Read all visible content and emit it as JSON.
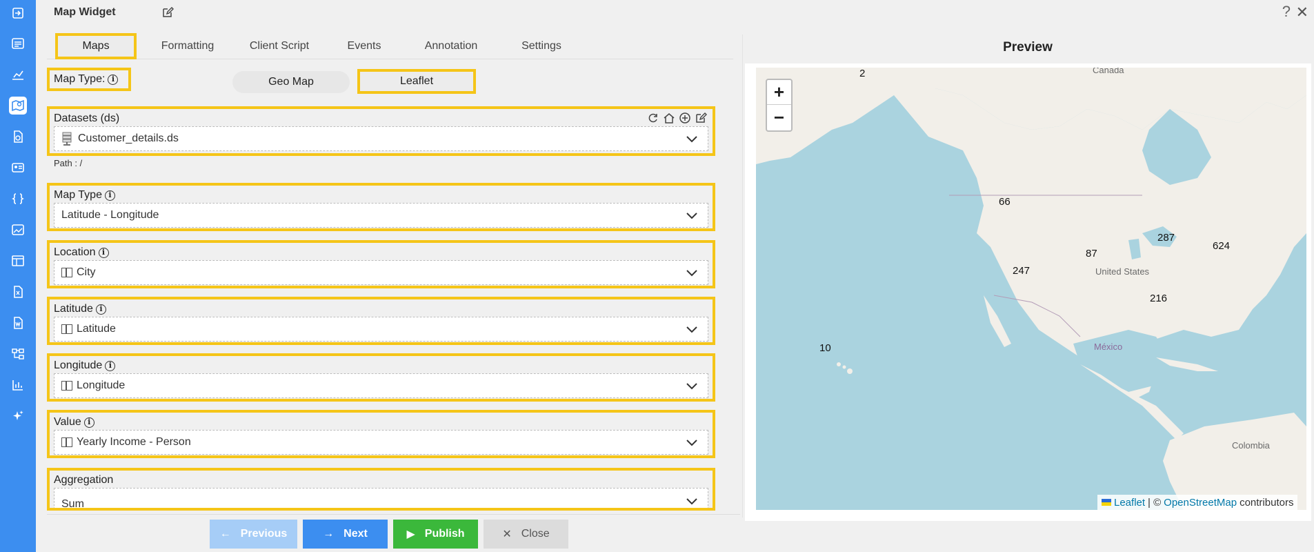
{
  "window": {
    "title": "Map Widget"
  },
  "tabs": [
    {
      "label": "Maps"
    },
    {
      "label": "Formatting"
    },
    {
      "label": "Client Script"
    },
    {
      "label": "Events"
    },
    {
      "label": "Annotation"
    },
    {
      "label": "Settings"
    }
  ],
  "map_type_top": {
    "label": "Map Type:",
    "options": [
      "Geo Map",
      "Leaflet"
    ],
    "selected": "Leaflet"
  },
  "datasets": {
    "label": "Datasets (ds)",
    "value": "Customer_details.ds",
    "path": "Path : /"
  },
  "fields": {
    "map_type": {
      "label": "Map Type",
      "value": "Latitude - Longitude"
    },
    "location": {
      "label": "Location",
      "value": "City"
    },
    "latitude": {
      "label": "Latitude",
      "value": "Latitude"
    },
    "longitude": {
      "label": "Longitude",
      "value": "Longitude"
    },
    "value": {
      "label": "Value",
      "value": "Yearly Income - Person"
    },
    "aggregation": {
      "label": "Aggregation",
      "value": "Sum"
    }
  },
  "buttons": {
    "previous": "Previous",
    "next": "Next",
    "publish": "Publish",
    "close": "Close"
  },
  "preview": {
    "title": "Preview",
    "zoom_in": "+",
    "zoom_out": "−",
    "bubble_values": [
      "2",
      "66",
      "87",
      "287",
      "624",
      "247",
      "216",
      "10"
    ],
    "places": {
      "canada": "Canada",
      "usa": "United States",
      "mexico": "México",
      "colombia": "Colombia"
    },
    "attribution": {
      "leaflet": "Leaflet",
      "sep": "| ©",
      "osm": "OpenStreetMap",
      "contrib": "contributors"
    }
  },
  "colors": {
    "accent": "#3c8ef0",
    "highlight": "#f5c518",
    "publish": "#3bb83b",
    "water": "#aad3df",
    "land": "#f2efe9"
  }
}
